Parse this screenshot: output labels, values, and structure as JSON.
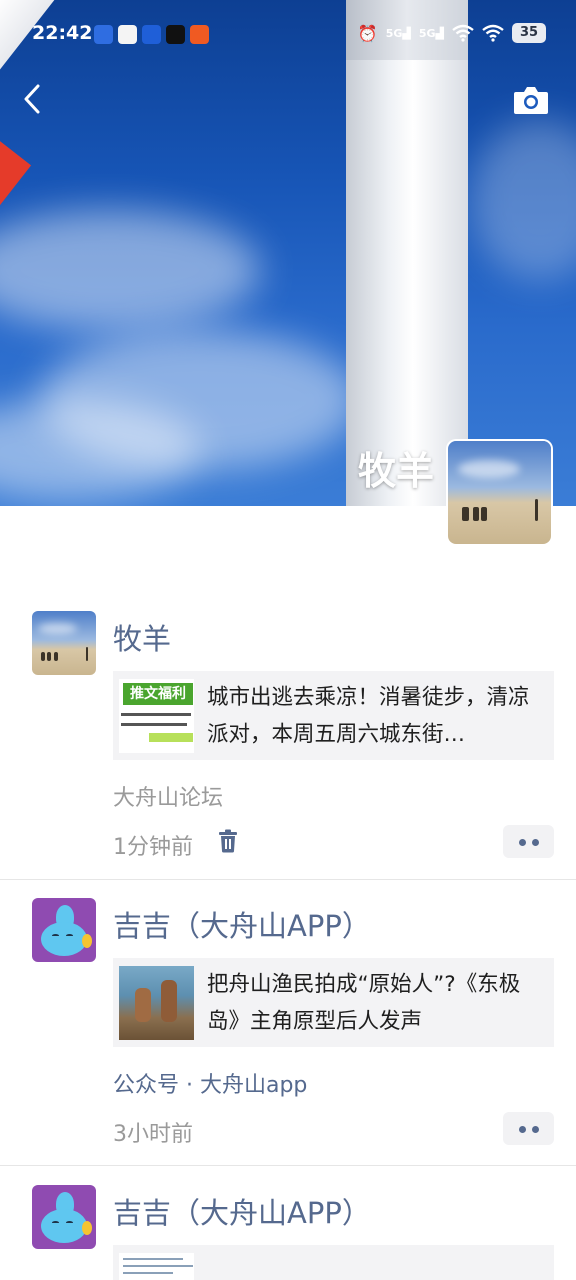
{
  "status_bar": {
    "time": "22:42",
    "network_1": "5G",
    "network_2": "5G",
    "battery": "35"
  },
  "icons": {
    "back": "chevron-left-icon",
    "camera": "camera-icon",
    "delete": "trash-icon",
    "more": "more-dots-icon"
  },
  "profile": {
    "name": "牧羊"
  },
  "feed": [
    {
      "author": "牧羊",
      "link_title": "城市出逃去乘凉！消暑徒步，清凉派对，本周五周六城东街…",
      "thumb_label": "推文福利",
      "source": "大舟山论坛",
      "time": "1分钟前"
    },
    {
      "author": "吉吉（大舟山APP）",
      "link_title": "把舟山渔民拍成“原始人”?《东极岛》主角原型后人发声",
      "source": "公众号 · 大舟山app",
      "time": "3小时前"
    },
    {
      "author": "吉吉（大舟山APP）"
    }
  ],
  "colors": {
    "name_link": "#55698e",
    "meta_gray": "#9a9a9a",
    "card_bg": "#f3f3f5",
    "sky_blue": "#1755b6"
  }
}
